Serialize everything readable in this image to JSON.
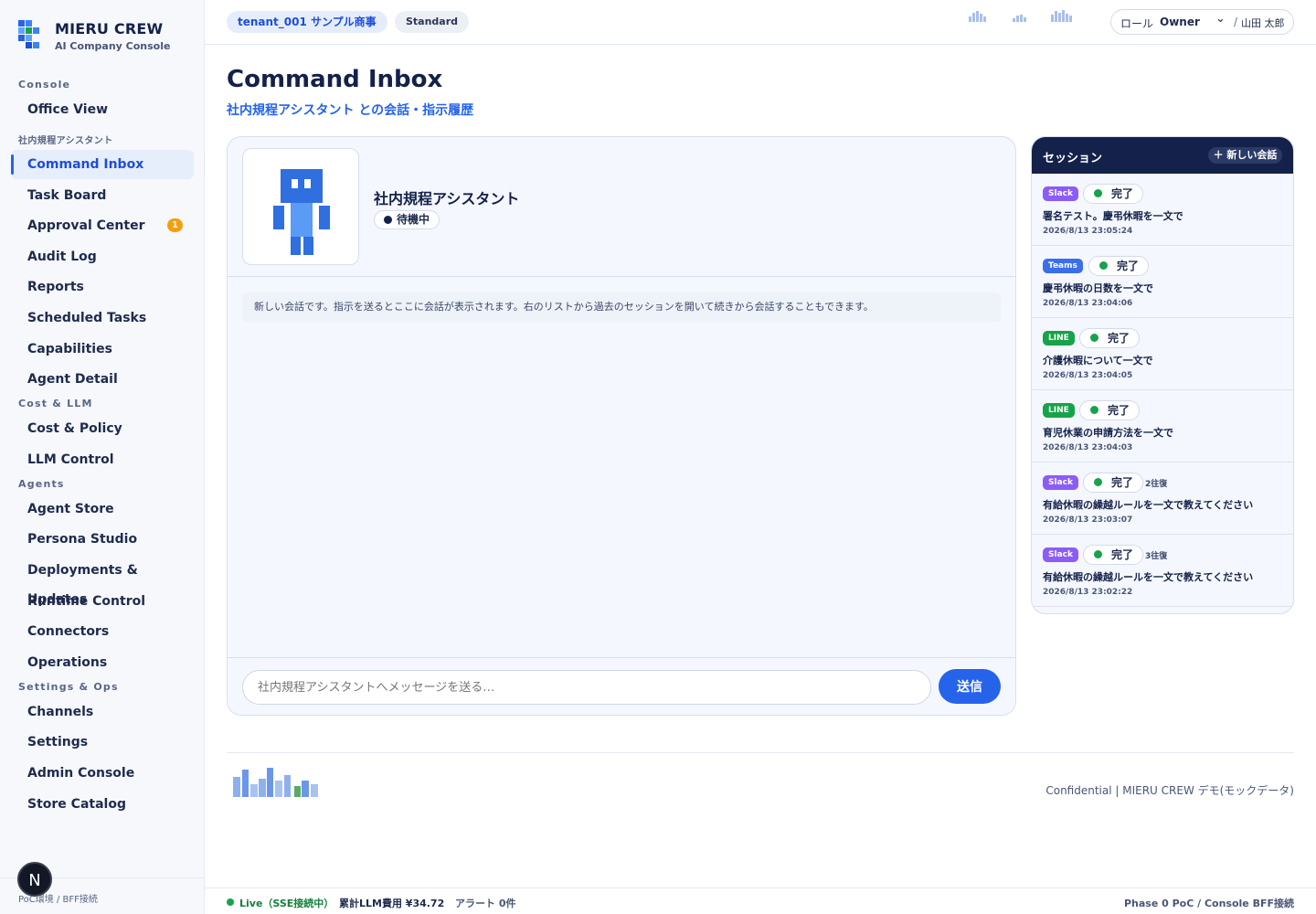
{
  "brand": {
    "title": "MIERU CREW",
    "subtitle": "AI Company Console"
  },
  "nav": {
    "sections": [
      {
        "label": "Console",
        "items": [
          {
            "label": "Office View"
          }
        ]
      },
      {
        "label": "社内規程アシスタント",
        "items": [
          {
            "label": "Command Inbox",
            "active": true
          },
          {
            "label": "Task Board"
          },
          {
            "label": "Approval Center",
            "badge": "1"
          },
          {
            "label": "Audit Log"
          },
          {
            "label": "Reports"
          },
          {
            "label": "Scheduled Tasks"
          },
          {
            "label": "Capabilities"
          },
          {
            "label": "Agent Detail"
          }
        ]
      },
      {
        "label": "Cost & LLM",
        "items": [
          {
            "label": "Cost & Policy"
          },
          {
            "label": "LLM Control"
          }
        ]
      },
      {
        "label": "Agents",
        "items": [
          {
            "label": "Agent Store"
          },
          {
            "label": "Persona Studio"
          },
          {
            "label": "Deployments & Updates"
          },
          {
            "label": "Runtime Control"
          },
          {
            "label": "Connectors"
          },
          {
            "label": "Operations"
          }
        ]
      },
      {
        "label": "Settings & Ops",
        "items": [
          {
            "label": "Channels"
          },
          {
            "label": "Settings"
          },
          {
            "label": "Admin Console"
          },
          {
            "label": "Store Catalog"
          }
        ]
      }
    ],
    "footer": "PoC環境 / BFF接続",
    "avatar_letter": "N"
  },
  "header": {
    "tenant": "tenant_001 サンプル商事",
    "plan": "Standard",
    "role_label": "ロール",
    "role_value": "Owner",
    "separator": "/",
    "user": "山田 太郎"
  },
  "main": {
    "title": "Command Inbox",
    "subtitle": "社内規程アシスタント との会話・指示履歴"
  },
  "chat": {
    "agent_name": "社内規程アシスタント",
    "status": "待機中",
    "empty_message": "新しい会話です。指示を送るとここに会話が表示されます。右のリストから過去のセッションを開いて続きから会話することもできます。",
    "input_placeholder": "社内規程アシスタントへメッセージを送る…",
    "send_label": "送信"
  },
  "sessions": {
    "title": "セッション",
    "new_label": "＋ 新しい会話",
    "items": [
      {
        "channel": "Slack",
        "status": "完了",
        "turns": "",
        "title": "署名テスト。慶弔休暇を一文で",
        "time": "2026/8/13 23:05:24"
      },
      {
        "channel": "Teams",
        "status": "完了",
        "turns": "",
        "title": "慶弔休暇の日数を一文で",
        "time": "2026/8/13 23:04:06"
      },
      {
        "channel": "LINE",
        "status": "完了",
        "turns": "",
        "title": "介護休暇について一文で",
        "time": "2026/8/13 23:04:05"
      },
      {
        "channel": "LINE",
        "status": "完了",
        "turns": "",
        "title": "育児休業の申請方法を一文で",
        "time": "2026/8/13 23:04:03"
      },
      {
        "channel": "Slack",
        "status": "完了",
        "turns": "2往復",
        "title": "有給休暇の繰越ルールを一文で教えてください",
        "time": "2026/8/13 23:03:07"
      },
      {
        "channel": "Slack",
        "status": "完了",
        "turns": "3往復",
        "title": "有給休暇の繰越ルールを一文で教えてください",
        "time": "2026/8/13 23:02:22"
      }
    ],
    "channel_colors": {
      "Slack": "#8b5cf6",
      "Teams": "#3b6fe8",
      "LINE": "#16a34a"
    }
  },
  "footer": {
    "confidential": "Confidential | MIERU CREW デモ(モックデータ)"
  },
  "statusbar": {
    "live": "Live（SSE接続中）",
    "cost": "累計LLM費用 ¥34.72",
    "alerts": "アラート 0件",
    "phase": "Phase 0 PoC / Console BFF接続"
  },
  "colors": {
    "accent": "#2563eb",
    "navy": "#14214a",
    "success": "#16a34a",
    "warning": "#f59e0b"
  }
}
